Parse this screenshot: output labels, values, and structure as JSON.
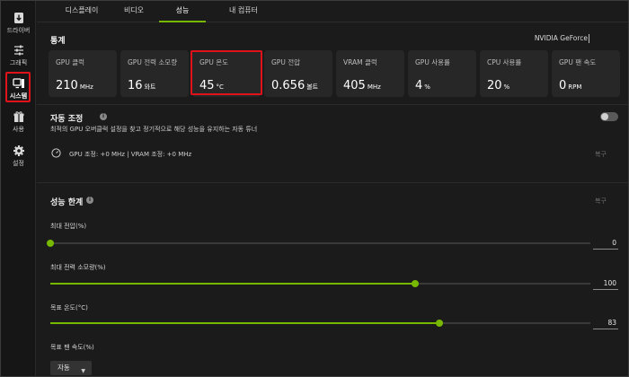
{
  "sidebar": {
    "items": [
      {
        "label": "드라이버",
        "icon": "driver-download-icon"
      },
      {
        "label": "그래픽",
        "icon": "graphics-sliders-icon"
      },
      {
        "label": "시스템",
        "icon": "system-monitor-icon"
      },
      {
        "label": "사용",
        "icon": "gift-icon"
      },
      {
        "label": "설정",
        "icon": "gear-icon"
      }
    ],
    "active": "시스템"
  },
  "tabs": [
    {
      "label": "디스플레이"
    },
    {
      "label": "비디오"
    },
    {
      "label": "성능"
    },
    {
      "label": "내 컴퓨터"
    }
  ],
  "stats": {
    "title": "통계",
    "gpu_name": "NVIDIA GeForce",
    "cards": [
      {
        "label": "GPU 클럭",
        "value": "210",
        "unit": "MHz"
      },
      {
        "label": "GPU 전력 소모량",
        "value": "16",
        "unit": "와트"
      },
      {
        "label": "GPU 온도",
        "value": "45",
        "unit": "°C"
      },
      {
        "label": "GPU 전압",
        "value": "0.656",
        "unit": "볼트"
      },
      {
        "label": "VRAM 클럭",
        "value": "405",
        "unit": "MHz"
      },
      {
        "label": "GPU 사용률",
        "value": "4",
        "unit": "%"
      },
      {
        "label": "CPU 사용률",
        "value": "20",
        "unit": "%"
      },
      {
        "label": "GPU 팬 속도",
        "value": "0",
        "unit": "RPM"
      }
    ]
  },
  "auto_tune": {
    "title": "자동 조정",
    "description": "최적의 GPU 오버클럭 설정을 찾고 정기적으로 해당 성능을 유지하는 자동 튜너",
    "status": "GPU 조정: +0 MHz   |  VRAM 조정: +0 MHz",
    "reset": "복구",
    "enabled": false
  },
  "limits": {
    "title": "성능 한계",
    "reset": "복구",
    "sliders": [
      {
        "label": "최대 전압(%)",
        "value": "0",
        "fraction": 0.0
      },
      {
        "label": "최대 전력 소모량(%)",
        "value": "100",
        "fraction": 0.675
      },
      {
        "label": "목표 온도(°C)",
        "value": "83",
        "fraction": 0.72
      }
    ],
    "fan_label": "목표 팬 속도(%)",
    "fan_mode": "자동"
  },
  "colors": {
    "accent": "#76b900",
    "highlight": "#e0121a"
  }
}
